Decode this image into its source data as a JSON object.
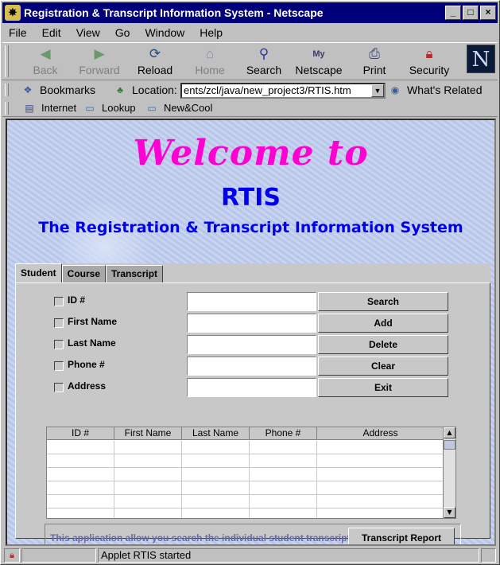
{
  "window": {
    "title": "Registration & Transcript Information System - Netscape",
    "controls": {
      "minimize": "_",
      "maximize": "□",
      "close": "×"
    }
  },
  "menu": [
    "File",
    "Edit",
    "View",
    "Go",
    "Window",
    "Help"
  ],
  "toolbar": {
    "buttons": [
      {
        "label": "Back",
        "icon": "back-arrow-icon",
        "enabled": false
      },
      {
        "label": "Forward",
        "icon": "forward-arrow-icon",
        "enabled": false
      },
      {
        "label": "Reload",
        "icon": "reload-icon",
        "enabled": true
      },
      {
        "label": "Home",
        "icon": "home-icon",
        "enabled": false
      },
      {
        "label": "Search",
        "icon": "search-icon",
        "enabled": true
      },
      {
        "label": "Netscape",
        "icon": "netscape-icon",
        "enabled": true
      },
      {
        "label": "Print",
        "icon": "print-icon",
        "enabled": true
      },
      {
        "label": "Security",
        "icon": "lock-icon",
        "enabled": true
      }
    ],
    "logo": "N"
  },
  "location": {
    "bookmarks_label": "Bookmarks",
    "location_label": "Location:",
    "url": "ents/zcl/java/new_project3/RTIS.htm",
    "whats_related": "What's Related"
  },
  "personal_toolbar": [
    "Internet",
    "Lookup",
    "New&Cool"
  ],
  "page": {
    "welcome": "Welcome to",
    "app_name": "RTIS",
    "subtitle": "The Registration & Transcript Information System"
  },
  "applet": {
    "tabs": [
      {
        "label": "Student",
        "active": true
      },
      {
        "label": "Course",
        "active": false
      },
      {
        "label": "Transcript",
        "active": false
      }
    ],
    "fields": [
      {
        "label": "ID #",
        "button": "Search"
      },
      {
        "label": "First Name",
        "button": "Add"
      },
      {
        "label": "Last Name",
        "button": "Delete"
      },
      {
        "label": "Phone #",
        "button": "Clear"
      },
      {
        "label": "Address",
        "button": "Exit"
      }
    ],
    "table_columns": [
      "ID #",
      "First Name",
      "Last Name",
      "Phone #",
      "Address"
    ],
    "footer_text": "This application allow you search the individual student transcript",
    "report_button": "Transcript Report"
  },
  "status": {
    "message": "Applet RTIS started"
  }
}
